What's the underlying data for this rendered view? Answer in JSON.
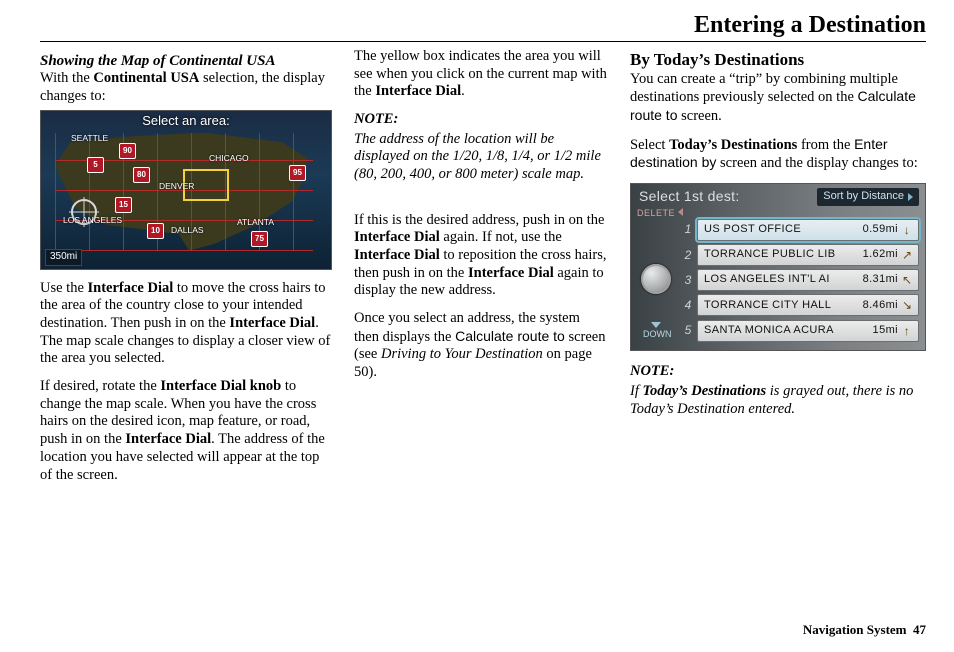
{
  "page_title": "Entering a Destination",
  "footer": {
    "label": "Navigation System",
    "page": "47"
  },
  "col1": {
    "heading": "Showing the Map of Continental USA",
    "intro_a": "With the ",
    "intro_bold": "Continental USA",
    "intro_b": " selection, the display changes to:",
    "map": {
      "title": "Select an area:",
      "scale": "350mi",
      "cities": {
        "seattle": "SEATTLE",
        "chicago": "CHICAGO",
        "denver": "DENVER",
        "dallas": "DALLAS",
        "atlanta": "ATLANTA",
        "la": "LOS ANGELES"
      },
      "shields": {
        "i5": "5",
        "i90": "90",
        "i80": "80",
        "i15": "15",
        "i10": "10",
        "i95": "95",
        "i75": "75"
      }
    },
    "p2_a": "Use the ",
    "p2_b1": "Interface Dial",
    "p2_b": " to move the cross hairs to the area of the country close to your intended destination. Then push in on the ",
    "p2_b2": "Interface Dial",
    "p2_c": ". The map scale changes to display a closer view of the area you selected.",
    "p3_a": "If desired, rotate the ",
    "p3_b1": "Interface Dial knob",
    "p3_b": " to change the map scale. When you have the cross hairs on the desired icon, map feature, or road, push in on the ",
    "p3_b2": "Interface Dial",
    "p3_c": ". The address of the location you have selected will appear at the top of the screen."
  },
  "col2": {
    "p1_a": "The yellow box indicates the area you will see when you click on the current map with the ",
    "p1_b": "Interface Dial",
    "p1_c": ".",
    "note_label": "NOTE:",
    "note_body": "The address of the location will be displayed on the 1/20, 1/8, 1/4, or 1/2 mile (80, 200, 400, or 800 meter) scale map.",
    "p2_a": "If this is the desired address, push in on the ",
    "p2_b1": "Interface Dial",
    "p2_b": " again. If not, use the ",
    "p2_b2": "Interface Dial",
    "p2_c": " to reposition the cross hairs, then push in on the ",
    "p2_b3": "Interface Dial",
    "p2_d": " again to display the new address.",
    "p3_a": "Once you select an address, the system then displays the ",
    "p3_sans": "Calculate route to",
    "p3_b": " screen (see ",
    "p3_ital": "Driving to Your Destination",
    "p3_c": " on page 50)."
  },
  "col3": {
    "heading": "By Today’s Destinations",
    "p1_a": "You can create a “trip” by combining multiple destinations previously selected on the ",
    "p1_sans": "Calculate route to",
    "p1_b": " screen.",
    "p2_a": "Select ",
    "p2_b1": "Today’s Destinations",
    "p2_b": " from the ",
    "p2_sans": "Enter destination by",
    "p2_c": " screen and the display changes to:",
    "fig": {
      "header": "Select 1st dest:",
      "sort": "Sort by Distance",
      "delete": "DELETE",
      "down": "DOWN",
      "rows": [
        {
          "n": "1",
          "name": "US POST OFFICE",
          "dist": "0.59mi",
          "dir": "↓"
        },
        {
          "n": "2",
          "name": "TORRANCE PUBLIC LIB",
          "dist": "1.62mi",
          "dir": "↗"
        },
        {
          "n": "3",
          "name": "LOS ANGELES INT'L AI",
          "dist": "8.31mi",
          "dir": "↖"
        },
        {
          "n": "4",
          "name": "TORRANCE CITY HALL",
          "dist": "8.46mi",
          "dir": "↘"
        },
        {
          "n": "5",
          "name": "SANTA MONICA ACURA",
          "dist": "15mi",
          "dir": "↑"
        }
      ]
    },
    "note_label": "NOTE:",
    "note_a": "If ",
    "note_b": "Today’s Destinations",
    "note_c": " is grayed out, there is no Today’s Destination entered."
  }
}
